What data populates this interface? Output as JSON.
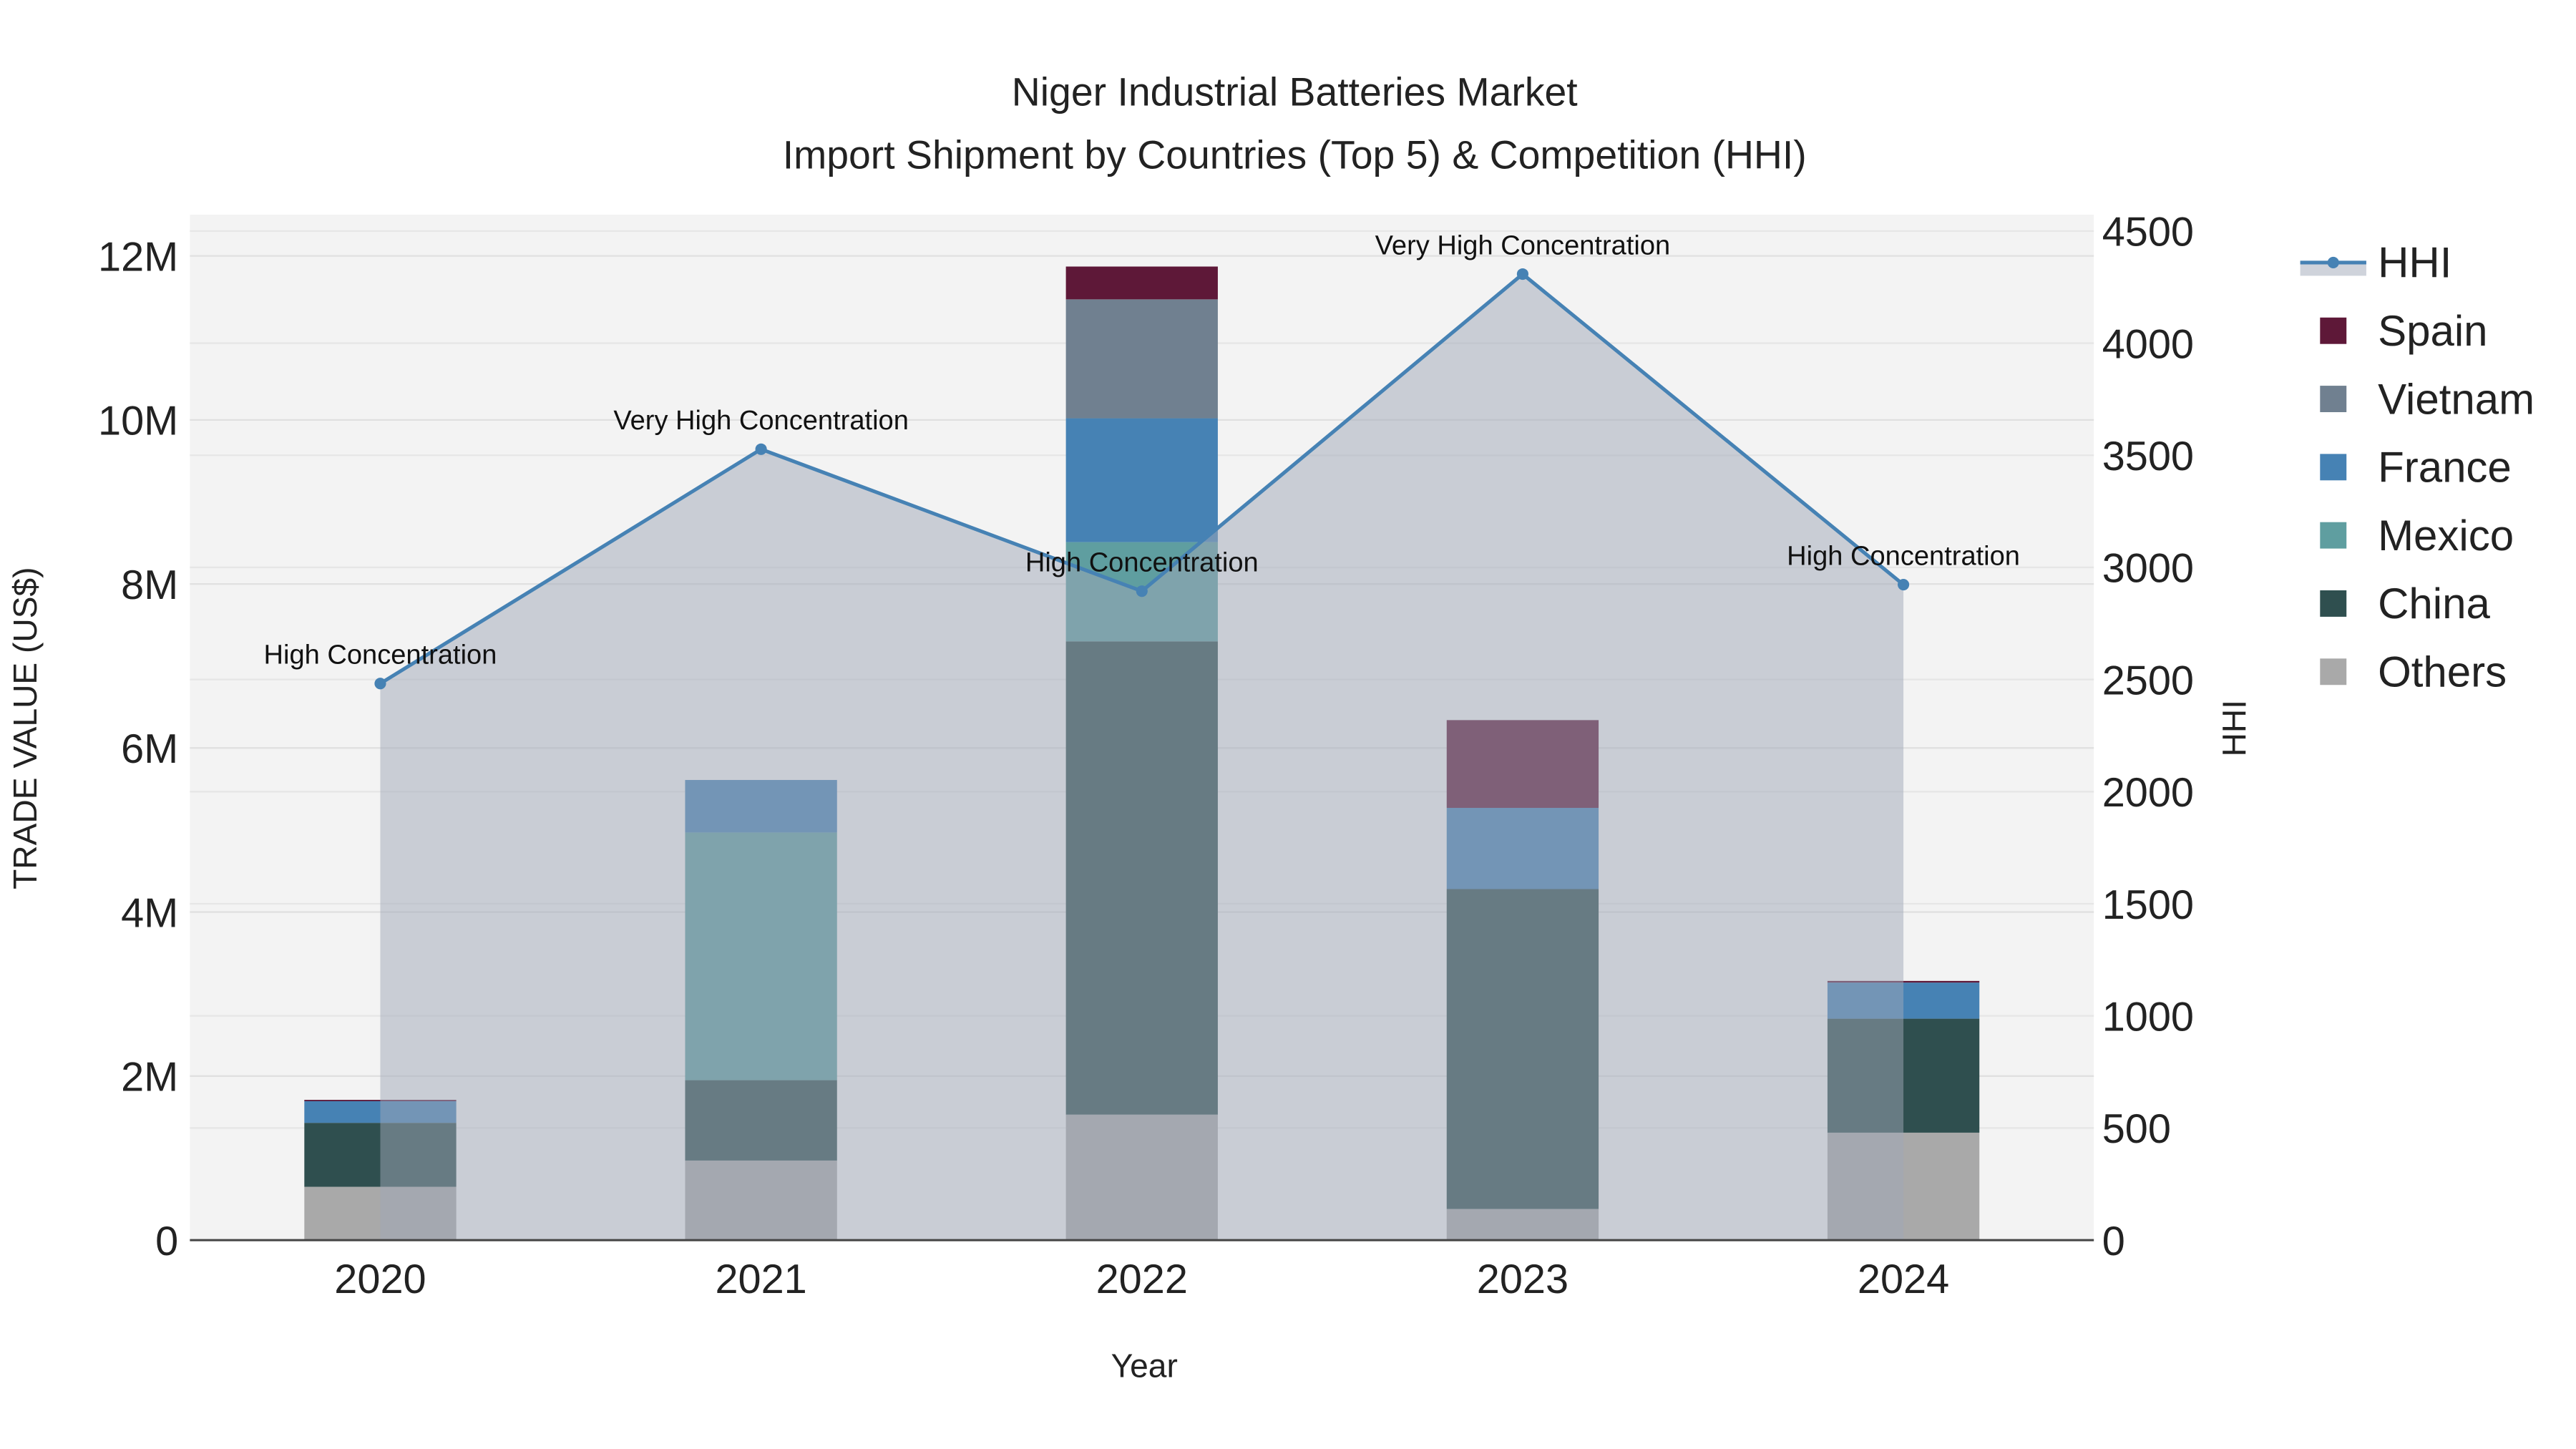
{
  "chart_data": {
    "type": "bar",
    "title": "Niger Industrial Batteries Market",
    "subtitle": "Import Shipment by Countries (Top 5) & Competition (HHI)",
    "xlabel": "Year",
    "ylabel": "TRADE VALUE (US$)",
    "y2label": "HHI",
    "categories": [
      "2020",
      "2021",
      "2022",
      "2023",
      "2024"
    ],
    "ylim": [
      0,
      12500000
    ],
    "y2lim": [
      0,
      4600
    ],
    "yticks": [
      0,
      2000000,
      4000000,
      6000000,
      8000000,
      10000000,
      12000000
    ],
    "ytick_labels": [
      "0",
      "2M",
      "4M",
      "6M",
      "8M",
      "10M",
      "12M"
    ],
    "y2ticks": [
      0,
      500,
      1000,
      1500,
      2000,
      2500,
      3000,
      3500,
      4000,
      4500
    ],
    "y2tick_labels": [
      "0",
      "500",
      "1000",
      "1500",
      "2000",
      "2500",
      "3000",
      "3500",
      "4000",
      "4500"
    ],
    "stacked": true,
    "series": [
      {
        "name": "Others",
        "color": "#a9a9a9",
        "values": [
          650000,
          970000,
          1530000,
          380000,
          1310000
        ]
      },
      {
        "name": "China",
        "color": "#2f4f4f",
        "values": [
          780000,
          980000,
          5770000,
          3900000,
          1390000
        ]
      },
      {
        "name": "Mexico",
        "color": "#5f9ea0",
        "values": [
          0,
          3020000,
          1210000,
          0,
          0
        ]
      },
      {
        "name": "France",
        "color": "#4682b4",
        "values": [
          270000,
          640000,
          1510000,
          990000,
          440000
        ]
      },
      {
        "name": "Vietnam",
        "color": "#708090",
        "values": [
          0,
          0,
          1450000,
          0,
          0
        ]
      },
      {
        "name": "Spain",
        "color": "#5e1838",
        "values": [
          10000,
          0,
          400000,
          1070000,
          20000
        ]
      }
    ],
    "hhi": {
      "name": "HHI",
      "color": "#4682b4",
      "values": [
        2482,
        3527,
        2894,
        4308,
        2923
      ],
      "annotations": [
        "High Concentration",
        "Very High Concentration",
        "High Concentration",
        "Very High Concentration",
        "High Concentration"
      ]
    },
    "legend_order": [
      "HHI",
      "Spain",
      "Vietnam",
      "France",
      "Mexico",
      "China",
      "Others"
    ],
    "legend_position": "right",
    "grid": true
  }
}
